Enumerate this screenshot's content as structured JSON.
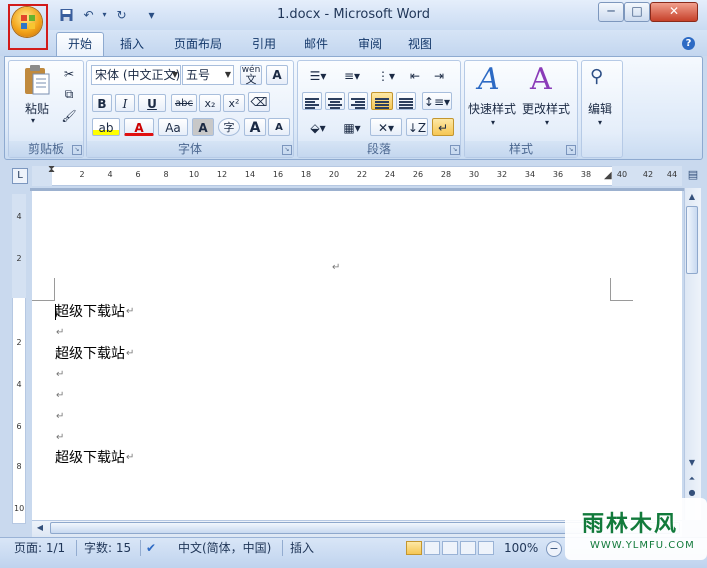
{
  "window": {
    "title": "1.docx - Microsoft Word",
    "controls": {
      "minimize": "─",
      "maximize": "□",
      "close": "✕"
    }
  },
  "quick_access": {
    "save_icon": "save-icon",
    "undo_icon": "undo-icon",
    "redo_icon": "redo-icon",
    "customize": "▾"
  },
  "tabs": [
    {
      "label": "开始",
      "active": true
    },
    {
      "label": "插入"
    },
    {
      "label": "页面布局"
    },
    {
      "label": "引用"
    },
    {
      "label": "邮件"
    },
    {
      "label": "审阅"
    },
    {
      "label": "视图"
    }
  ],
  "ribbon": {
    "clipboard": {
      "label": "剪贴板",
      "paste": "粘贴"
    },
    "font": {
      "label": "字体",
      "font_name": "宋体 (中文正文)",
      "font_size": "五号",
      "wen": "wén",
      "wen_char": "文",
      "bold": "B",
      "italic": "I",
      "underline": "U",
      "strike": "abc",
      "subscript": "x₂",
      "superscript": "x²",
      "aa": "Aa",
      "a": "A",
      "grow": "A",
      "shrink": "A",
      "circle": "字"
    },
    "paragraph": {
      "label": "段落"
    },
    "styles": {
      "label": "样式",
      "quick_styles": "快速样式",
      "change_styles": "更改样式"
    },
    "editing": {
      "label": "编辑"
    }
  },
  "ruler": {
    "ticks": [
      "2",
      "2",
      "4",
      "6",
      "8",
      "10",
      "12",
      "14",
      "16",
      "18",
      "20",
      "22",
      "24",
      "26",
      "28",
      "30",
      "32",
      "34",
      "36",
      "38",
      "40",
      "42",
      "44"
    ],
    "vticks": [
      "4",
      "2",
      "2",
      "4",
      "6",
      "8",
      "10"
    ]
  },
  "document": {
    "lines": [
      {
        "text": "超级下载站"
      },
      {
        "text": ""
      },
      {
        "text": "超级下载站"
      },
      {
        "text": ""
      },
      {
        "text": ""
      },
      {
        "text": ""
      },
      {
        "text": ""
      },
      {
        "text": "超级下载站"
      }
    ],
    "para_mark": "↵"
  },
  "status": {
    "page": "页面: 1/1",
    "words": "字数: 15",
    "language": "中文(简体，中国)",
    "mode": "插入",
    "zoom": "100%"
  },
  "watermark": {
    "main": "雨林木风",
    "sub": "WWW.YLMFU.COM"
  }
}
